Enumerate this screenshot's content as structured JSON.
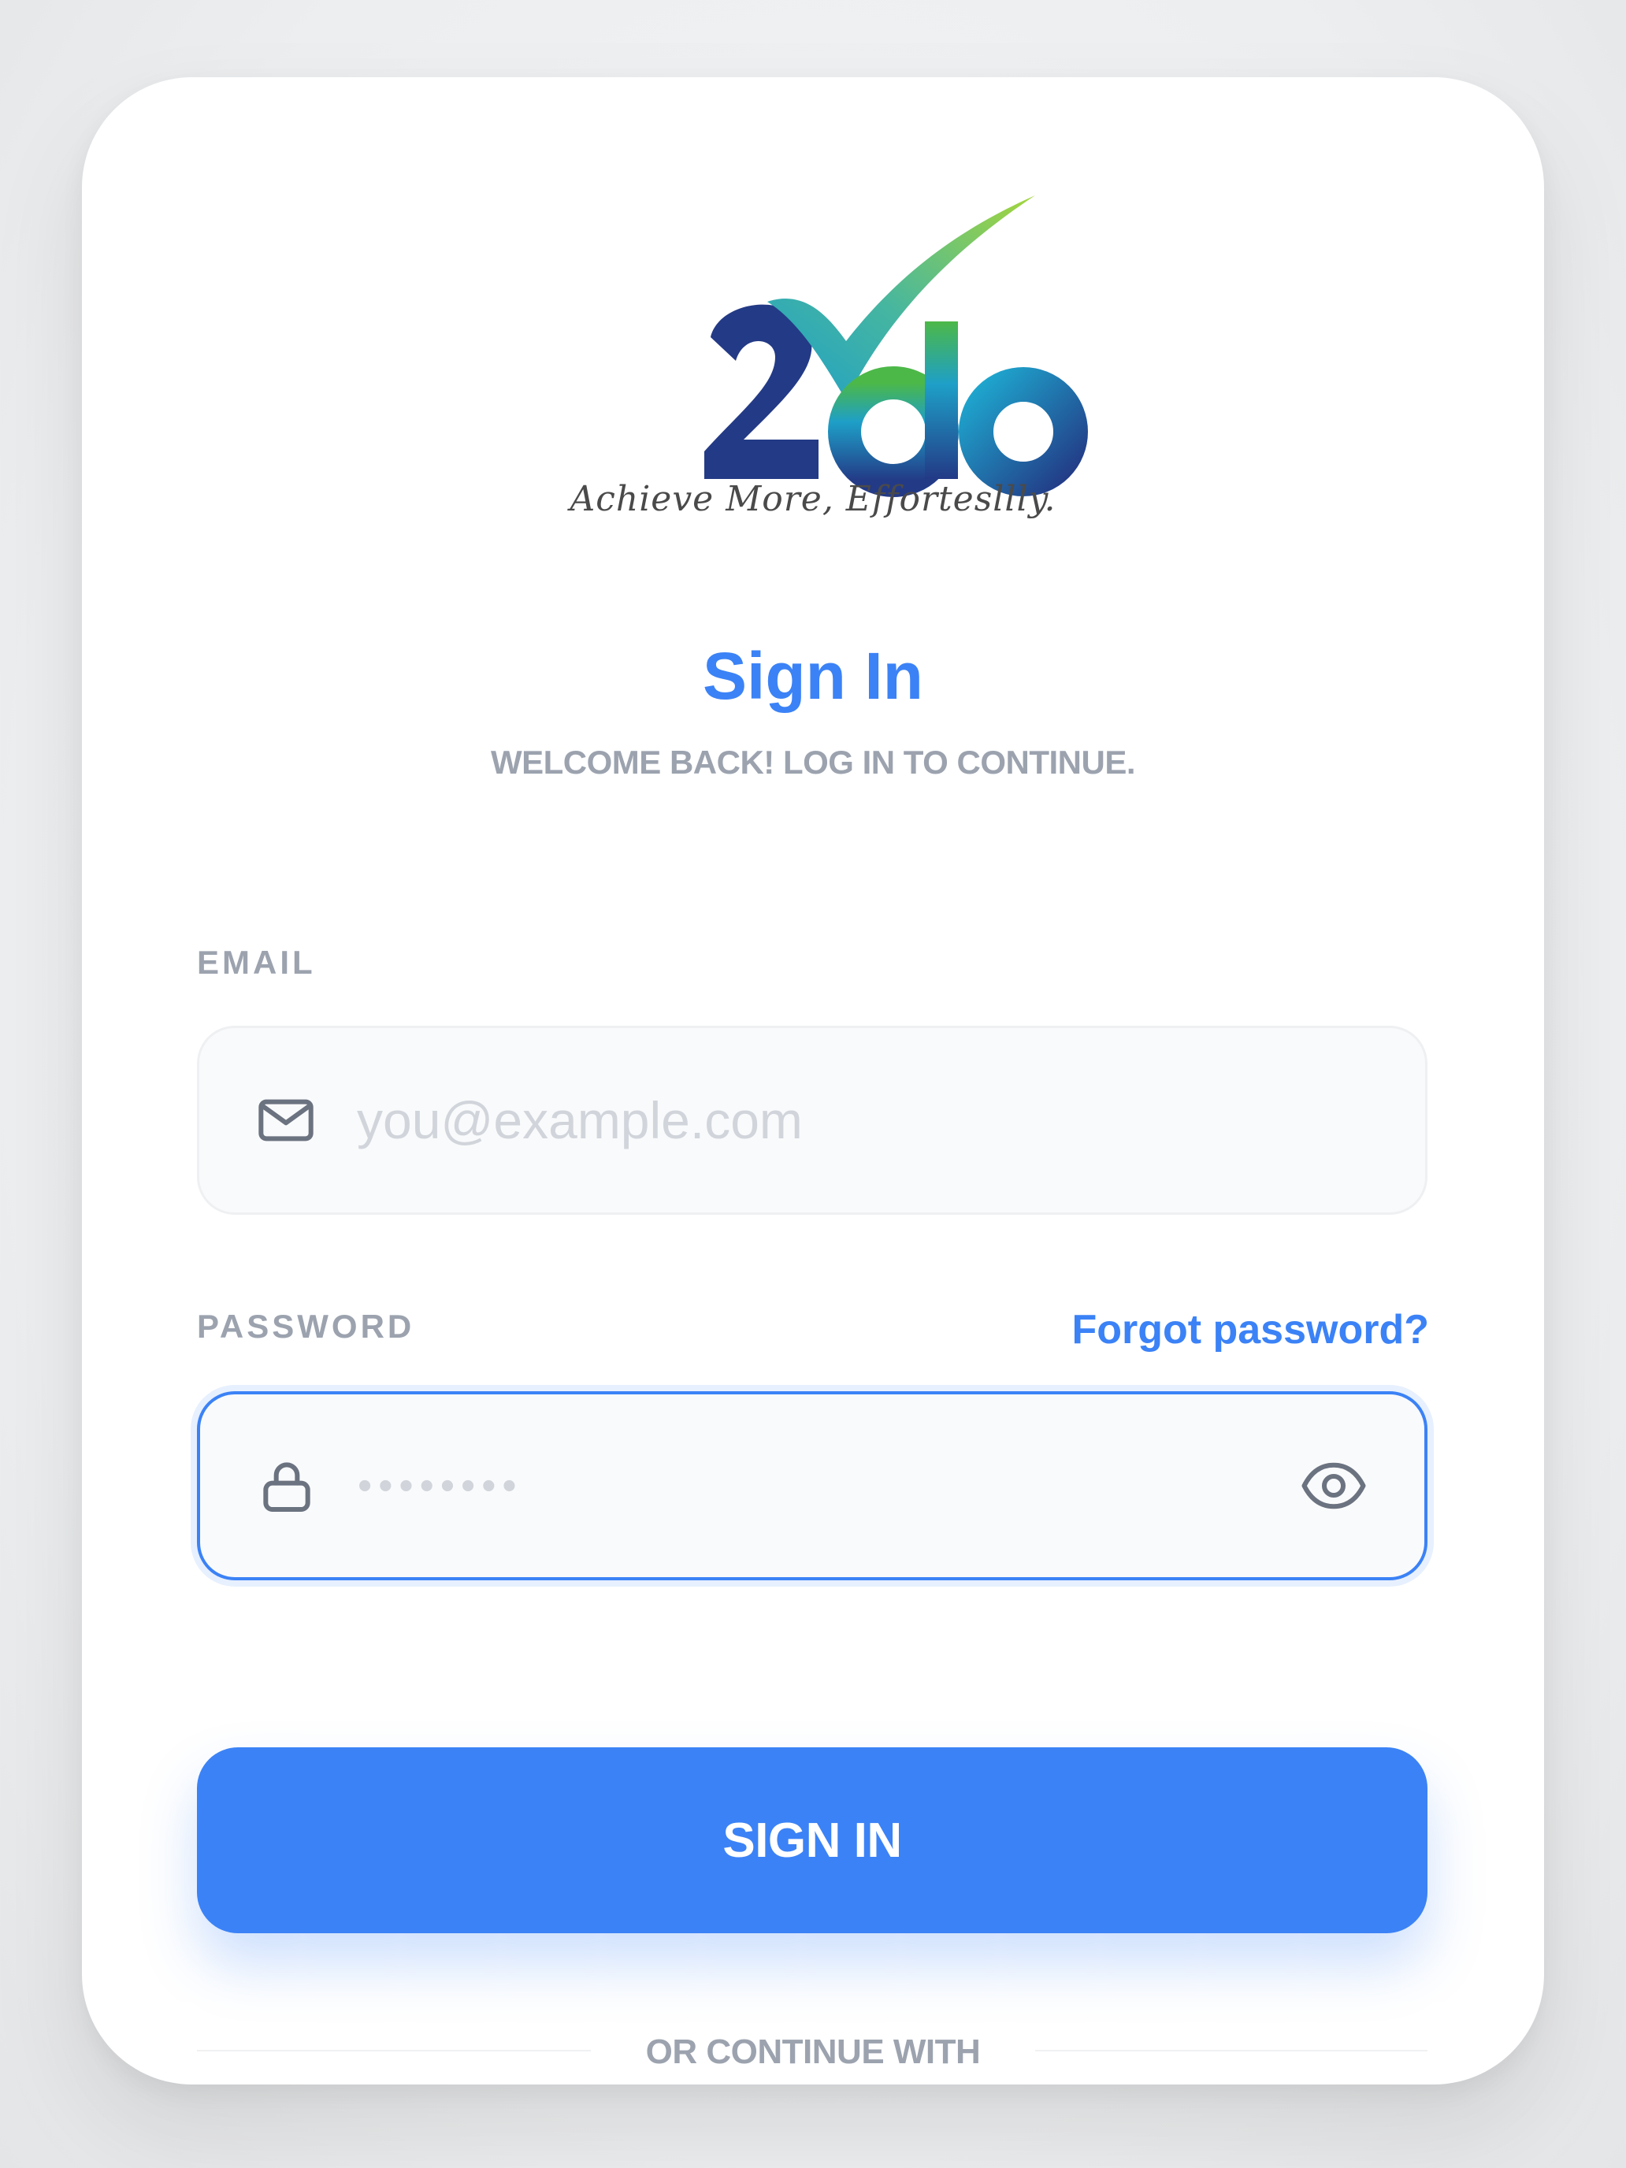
{
  "brand": {
    "logo_text": "2do",
    "tagline": "Achieve More, Effortesllly."
  },
  "header": {
    "title": "Sign In",
    "subtitle": "WELCOME BACK! LOG IN TO CONTINUE."
  },
  "form": {
    "email": {
      "label": "EMAIL",
      "placeholder": "you@example.com",
      "value": "",
      "icon": "mail-icon"
    },
    "password": {
      "label": "PASSWORD",
      "placeholder": "••••••••",
      "value": "",
      "icon": "lock-icon",
      "toggle_icon": "eye-icon",
      "forgot_label": "Forgot password?"
    },
    "submit_label": "SIGN IN",
    "divider_label": "OR CONTINUE WITH"
  },
  "colors": {
    "accent": "#3b82f6",
    "muted": "#9ca3af",
    "logo_dark": "#233a86",
    "logo_teal": "#1e9fc8",
    "logo_green": "#8cc63f"
  }
}
